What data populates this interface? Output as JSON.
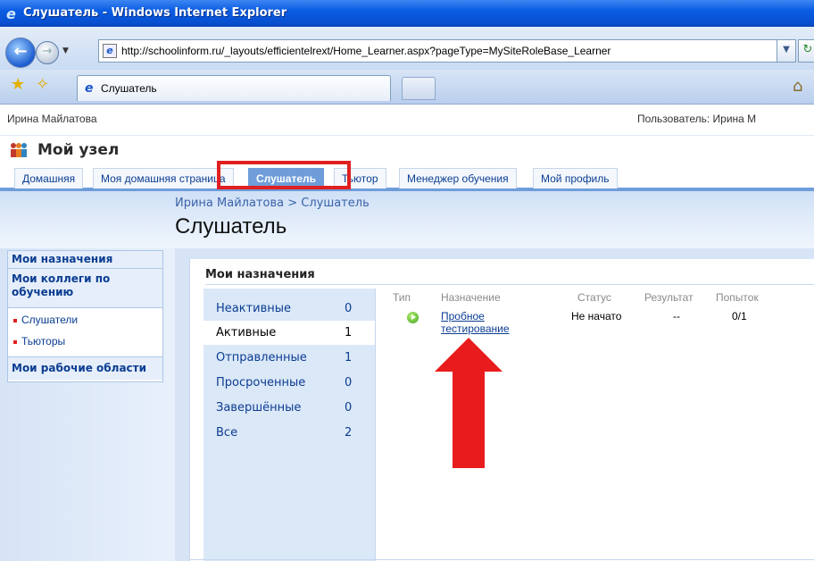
{
  "window": {
    "title": "Слушатель - Windows Internet Explorer",
    "url": "http://schoolinform.ru/_layouts/efficientelrext/Home_Learner.aspx?pageType=MySiteRoleBase_Learner",
    "tab_label": "Слушатель"
  },
  "header": {
    "user_left": "Ирина Майлатова",
    "user_right": "Пользователь: Ирина М",
    "site_title": "Мой узел"
  },
  "topnav": {
    "items": [
      "Домашняя",
      "Моя домашняя страница",
      "Слушатель",
      "Тьютор",
      "Менеджер обучения",
      "Мой профиль"
    ],
    "selected": "Слушатель"
  },
  "page": {
    "breadcrumb": "Ирина Майлатова > Слушатель",
    "title": "Слушатель"
  },
  "leftnav": {
    "heading1": "Мои назначения",
    "heading2": "Мои коллеги по обучению",
    "items": [
      "Слушатели",
      "Тьюторы"
    ],
    "heading3": "Мои рабочие области"
  },
  "assignments": {
    "title": "Мои назначения",
    "filters": [
      {
        "label": "Неактивные",
        "count": "0"
      },
      {
        "label": "Активные",
        "count": "1"
      },
      {
        "label": "Отправленные",
        "count": "1"
      },
      {
        "label": "Просроченные",
        "count": "0"
      },
      {
        "label": "Завершённые",
        "count": "0"
      },
      {
        "label": "Все",
        "count": "2"
      }
    ],
    "selected_filter": "Активные",
    "columns": [
      "Тип",
      "Назначение",
      "Статус",
      "Результат",
      "Попыток"
    ],
    "rows": [
      {
        "type_icon": "play-circle-icon",
        "name": "Пробное тестирование",
        "status": "Не начато",
        "result": "--",
        "attempts": "0/1"
      }
    ]
  },
  "colors": {
    "titlebar": "#0a5ce3",
    "nav_selected": "#6f9dd9",
    "highlight": "#e02020",
    "link": "#0b3d91"
  }
}
